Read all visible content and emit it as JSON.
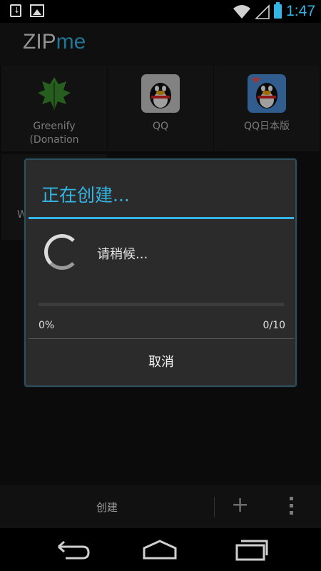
{
  "statusbar": {
    "time": "1:47",
    "left_icons": [
      "download-icon",
      "image-icon"
    ],
    "right_icons": [
      "wifi-icon",
      "signal-icon",
      "battery-icon"
    ]
  },
  "app": {
    "logo_zip": "ZIP",
    "logo_me": "me"
  },
  "grid": {
    "items": [
      {
        "label": "Greenify\n(Donation",
        "icon": "greenify-leaf-icon"
      },
      {
        "label": "QQ",
        "icon": "qq-penguin-icon"
      },
      {
        "label": "QQ日本版",
        "icon": "qq-japan-penguin-icon"
      },
      {
        "label": "W",
        "icon": ""
      }
    ]
  },
  "dialog": {
    "title": "正在创建...",
    "message": "请稍候...",
    "progress_percent": "0%",
    "progress_count": "0/10",
    "progress_fraction": 0,
    "cancel_label": "取消"
  },
  "bottombar": {
    "create_label": "创建",
    "add_icon": "plus-icon",
    "overflow_icon": "overflow-menu-icon"
  },
  "navbar": {
    "buttons": [
      "back-icon",
      "home-icon",
      "recents-icon"
    ]
  },
  "colors": {
    "accent": "#33b5e5",
    "background": "#111111",
    "dialog_bg": "#2b2b2b"
  }
}
